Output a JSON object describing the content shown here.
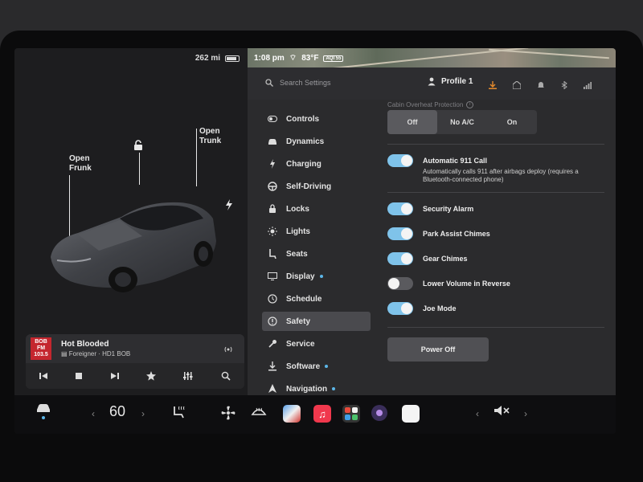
{
  "status": {
    "range": "262 mi",
    "battery_fraction": 0.85,
    "time": "1:08 pm",
    "temperature": "83°F",
    "aqi": "AQI 55"
  },
  "car": {
    "callout_frunk": "Open\nFrunk",
    "callout_trunk": "Open\nTrunk"
  },
  "media": {
    "station_logo": [
      "BOB",
      "FM",
      "103.5"
    ],
    "song": "Hot Blooded",
    "artist": "Foreigner · HD1 BOB"
  },
  "settings_header": {
    "search_placeholder": "Search Settings",
    "profile": "Profile 1"
  },
  "nav": {
    "items": [
      {
        "label": "Controls",
        "icon": "toggle-icon"
      },
      {
        "label": "Dynamics",
        "icon": "car-icon"
      },
      {
        "label": "Charging",
        "icon": "bolt-icon"
      },
      {
        "label": "Self-Driving",
        "icon": "steering-wheel-icon"
      },
      {
        "label": "Locks",
        "icon": "lock-icon"
      },
      {
        "label": "Lights",
        "icon": "sun-icon"
      },
      {
        "label": "Seats",
        "icon": "seat-icon"
      },
      {
        "label": "Display",
        "icon": "display-icon",
        "dot": true
      },
      {
        "label": "Schedule",
        "icon": "clock-icon"
      },
      {
        "label": "Safety",
        "icon": "safety-icon",
        "active": true
      },
      {
        "label": "Service",
        "icon": "wrench-icon"
      },
      {
        "label": "Software",
        "icon": "download-icon",
        "dot": true
      },
      {
        "label": "Navigation",
        "icon": "navigation-icon",
        "dot": true
      }
    ]
  },
  "content": {
    "overheat_label": "Cabin Overheat Protection",
    "overheat_options": [
      "Off",
      "No A/C",
      "On"
    ],
    "overheat_selected": "Off",
    "auto911": {
      "label": "Automatic 911 Call",
      "desc": "Automatically calls 911 after airbags deploy (requires a Bluetooth-connected phone)",
      "on": true
    },
    "toggles": [
      {
        "label": "Security Alarm",
        "on": true
      },
      {
        "label": "Park Assist Chimes",
        "on": true
      },
      {
        "label": "Gear Chimes",
        "on": true
      },
      {
        "label": "Lower Volume in Reverse",
        "on": false
      },
      {
        "label": "Joe Mode",
        "on": true
      }
    ],
    "power_off": "Power Off"
  },
  "dock": {
    "temperature": "60"
  },
  "colors": {
    "accent_blue": "#7fc3ea",
    "station_red": "#c4262e"
  }
}
